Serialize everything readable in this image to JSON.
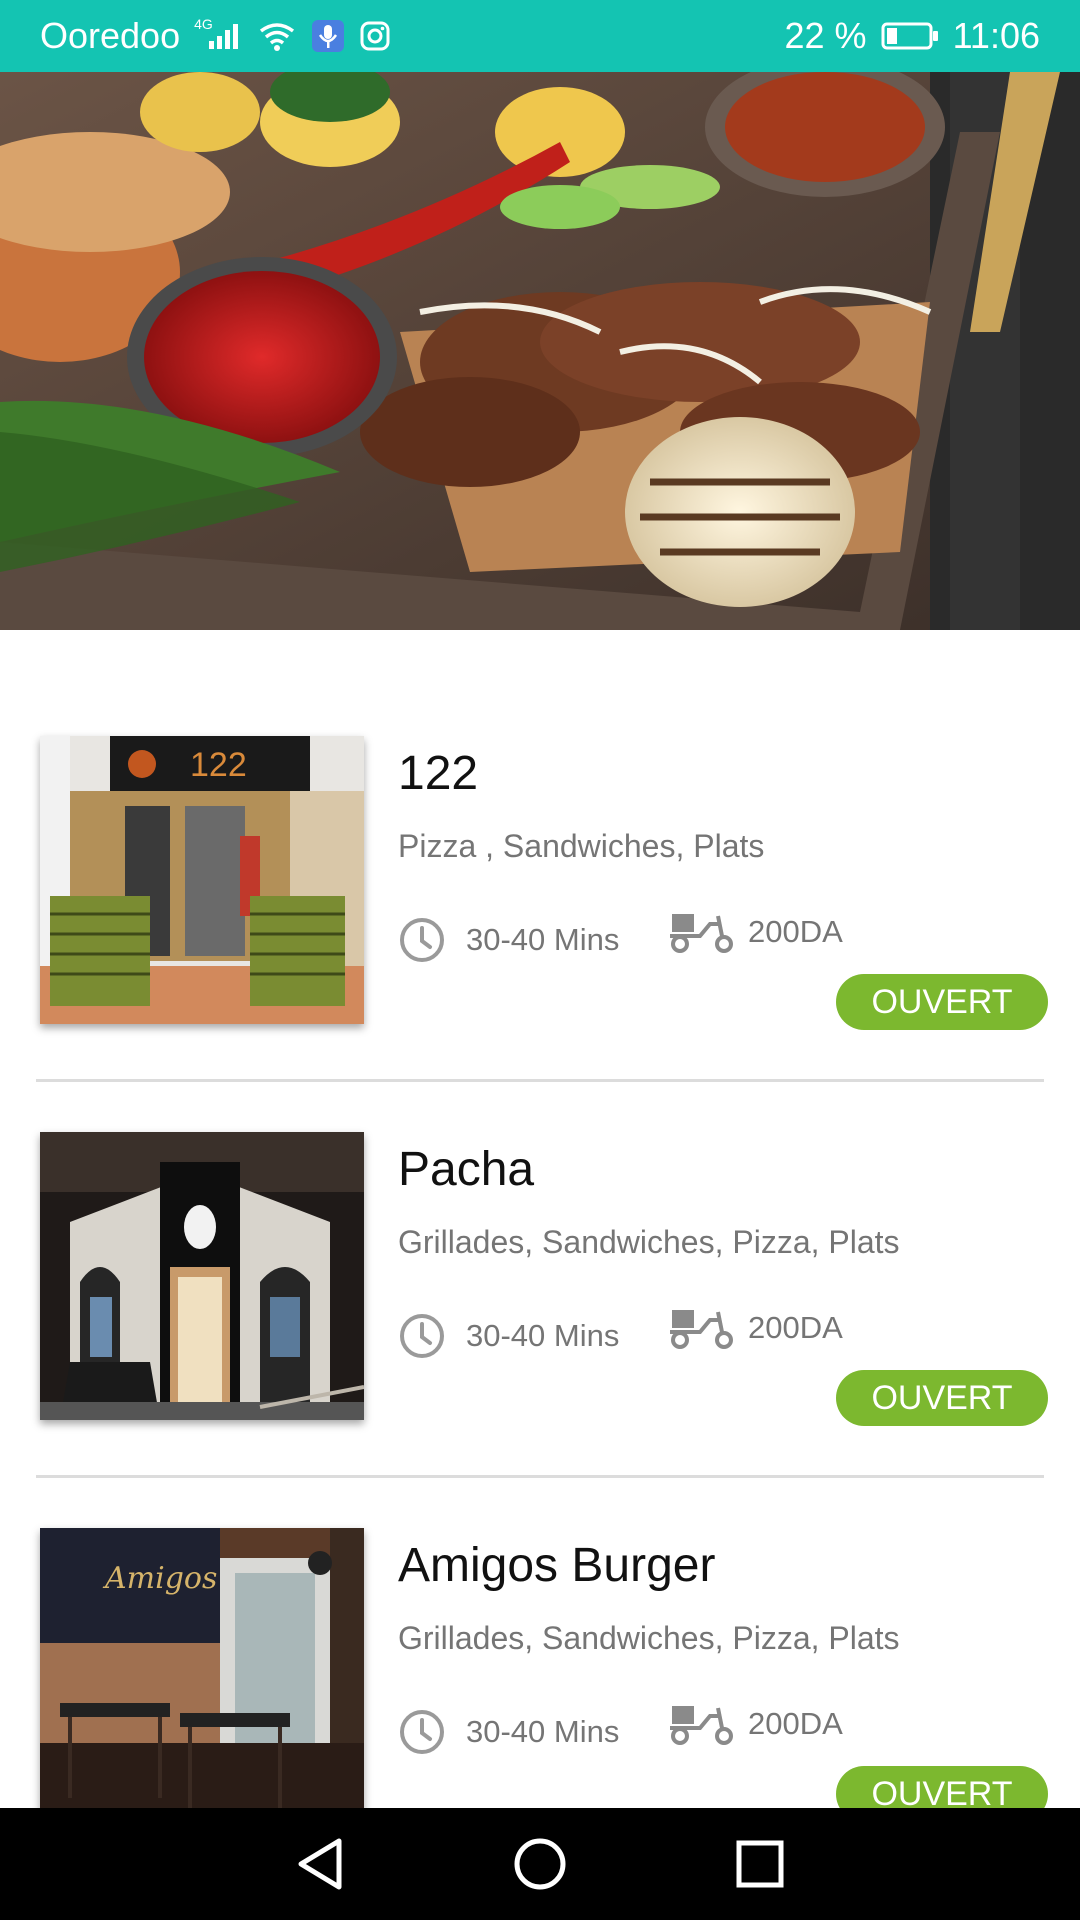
{
  "status_bar": {
    "carrier": "Ooredoo",
    "network": "4G",
    "battery": "22 %",
    "time": "11:06"
  },
  "restaurants": [
    {
      "name": "122",
      "categories": "Pizza , Sandwiches, Plats",
      "time": "30-40 Mins",
      "fee": "200DA",
      "status": "OUVERT",
      "sign_text": "122"
    },
    {
      "name": "Pacha",
      "categories": "Grillades, Sandwiches, Pizza, Plats",
      "time": "30-40 Mins",
      "fee": "200DA",
      "status": "OUVERT"
    },
    {
      "name": "Amigos Burger",
      "categories": "Grillades, Sandwiches, Pizza, Plats",
      "time": "30-40 Mins",
      "fee": "200DA",
      "status": "OUVERT",
      "sign_text": "Amigos"
    }
  ],
  "colors": {
    "status_bar": "#14c4b2",
    "open_badge": "#7cb82f"
  }
}
